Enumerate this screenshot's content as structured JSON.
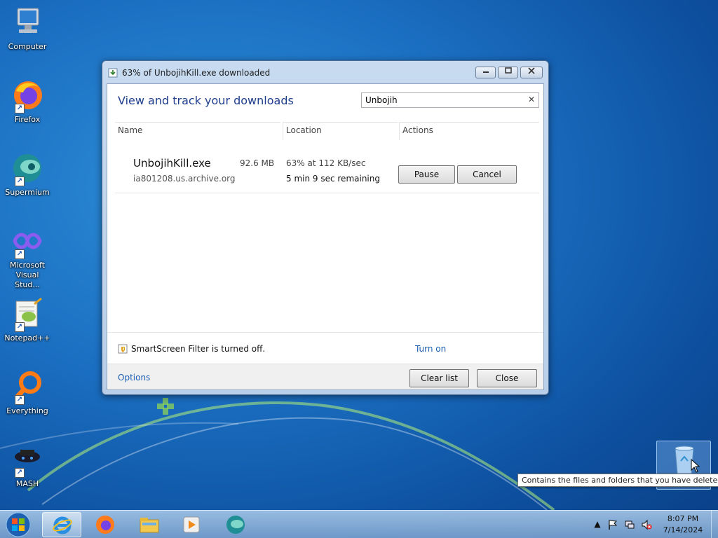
{
  "desktop": {
    "icons": [
      {
        "label": "Computer"
      },
      {
        "label": "Firefox"
      },
      {
        "label": "Supermium"
      },
      {
        "label": "Microsoft Visual Stud..."
      },
      {
        "label": "Notepad++"
      },
      {
        "label": "Everything"
      },
      {
        "label": "MASH"
      }
    ],
    "recycle_bin_tooltip": "Contains the files and folders that you have deleted."
  },
  "window": {
    "title": "63% of UnbojihKill.exe downloaded",
    "header_title": "View and track your downloads",
    "search": {
      "value": "Unbojih",
      "clear_icon": "✕"
    },
    "columns": {
      "name": "Name",
      "location": "Location",
      "actions": "Actions"
    },
    "downloads": [
      {
        "file": "UnbojihKill.exe",
        "host": "ia801208.us.archive.org",
        "size": "92.6 MB",
        "progress_text": "63% at 112 KB/sec",
        "progress": 0.63,
        "remaining": "5 min 9 sec remaining",
        "pause_label": "Pause",
        "cancel_label": "Cancel"
      }
    ],
    "smartscreen": {
      "text": "SmartScreen Filter is turned off.",
      "link": "Turn on"
    },
    "footer": {
      "options": "Options",
      "clear_list": "Clear list",
      "close": "Close"
    }
  },
  "taskbar": {
    "clock_time": "8:07 PM",
    "clock_date": "7/14/2024",
    "tray_arrow": "▲"
  }
}
